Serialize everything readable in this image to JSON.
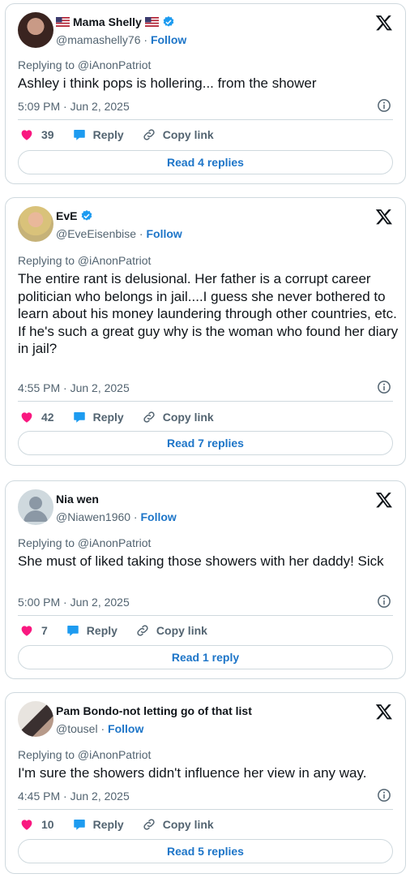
{
  "colors": {
    "like": "#f91880",
    "reply_icon": "#1d9bf0",
    "link_blue": "#1d75c8",
    "muted": "#536471"
  },
  "tweets": [
    {
      "name": "Mama Shelly",
      "handle": "@mamashelly76",
      "follow": "Follow",
      "replying_to": "Replying to @iAnonPatriot",
      "text": "Ashley i think pops is hollering... from the shower",
      "time": "5:09 PM · Jun 2, 2025",
      "likes": "39",
      "reply_label": "Reply",
      "copy_label": "Copy link",
      "read_replies": "Read 4 replies"
    },
    {
      "name": "EvE",
      "handle": "@EveEisenbise",
      "follow": "Follow",
      "replying_to": "Replying to @iAnonPatriot",
      "text": "The entire rant is delusional. Her father is a corrupt career politician who belongs in jail....I guess she never bothered to learn about his money laundering through other countries, etc.\nIf he's such a great guy why is the woman who found her diary in jail?",
      "time": "4:55 PM · Jun 2, 2025",
      "likes": "42",
      "reply_label": "Reply",
      "copy_label": "Copy link",
      "read_replies": "Read 7 replies"
    },
    {
      "name": "Nia wen",
      "handle": "@Niawen1960",
      "follow": "Follow",
      "replying_to": "Replying to @iAnonPatriot",
      "text": "She must of liked taking those showers with her daddy! Sick",
      "time": "5:00 PM · Jun 2, 2025",
      "likes": "7",
      "reply_label": "Reply",
      "copy_label": "Copy link",
      "read_replies": "Read 1 reply"
    },
    {
      "name": "Pam Bondo-not letting go of that list",
      "handle": "@tousel",
      "follow": "Follow",
      "replying_to": "Replying to @iAnonPatriot",
      "text": "I'm sure the showers didn't influence her view in any way.",
      "time": "4:45 PM · Jun 2, 2025",
      "likes": "10",
      "reply_label": "Reply",
      "copy_label": "Copy link",
      "read_replies": "Read 5 replies"
    }
  ]
}
